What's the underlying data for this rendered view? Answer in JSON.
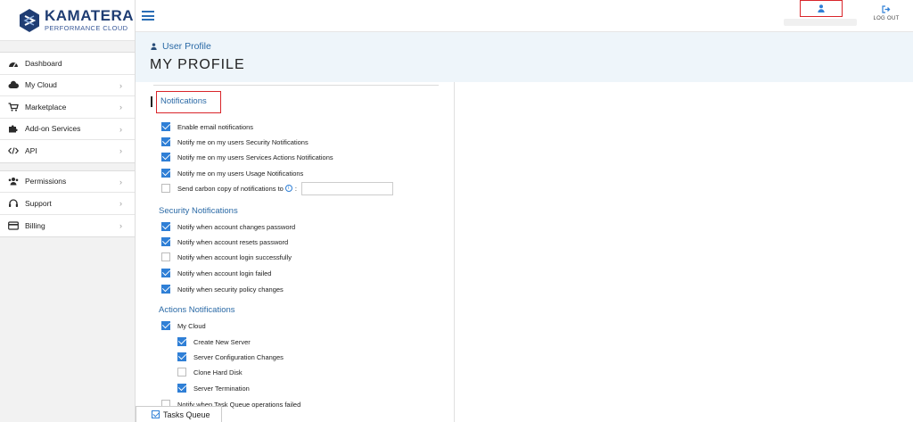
{
  "logo": {
    "name": "KAMATERA",
    "sub": "PERFORMANCE CLOUD"
  },
  "nav_group_1": [
    {
      "label": "Dashboard",
      "icon": "dashboard-icon",
      "chevron": false
    },
    {
      "label": "My Cloud",
      "icon": "cloud-icon",
      "chevron": true
    },
    {
      "label": "Marketplace",
      "icon": "cart-icon",
      "chevron": true
    },
    {
      "label": "Add-on Services",
      "icon": "puzzle-icon",
      "chevron": true
    },
    {
      "label": "API",
      "icon": "code-icon",
      "chevron": true
    }
  ],
  "nav_group_2": [
    {
      "label": "Permissions",
      "icon": "users-icon",
      "chevron": true
    },
    {
      "label": "Support",
      "icon": "headset-icon",
      "chevron": true
    },
    {
      "label": "Billing",
      "icon": "credit-card-icon",
      "chevron": true
    }
  ],
  "topbar": {
    "logout_label": "LOG OUT"
  },
  "header": {
    "breadcrumb": "User Profile",
    "title": "MY PROFILE"
  },
  "sections": {
    "notifications": "Notifications",
    "security": "Security Notifications",
    "actions": "Actions Notifications"
  },
  "notification_items": [
    {
      "label": "Enable email notifications",
      "checked": true
    },
    {
      "label": "Notify me on my users Security Notifications",
      "checked": true
    },
    {
      "label": "Notify me on my users Services Actions Notifications",
      "checked": true
    },
    {
      "label": "Notify me on my users Usage Notifications",
      "checked": true
    },
    {
      "label": "Send carbon copy of notifications to",
      "checked": false
    }
  ],
  "cc_suffix": ":",
  "security_items": [
    {
      "label": "Notify when account changes password",
      "checked": true
    },
    {
      "label": "Notify when account resets password",
      "checked": true
    },
    {
      "label": "Notify when account login successfully",
      "checked": false
    },
    {
      "label": "Notify when account login failed",
      "checked": true
    },
    {
      "label": "Notify when security policy changes",
      "checked": true
    }
  ],
  "action_parent": {
    "label": "My Cloud",
    "checked": true
  },
  "action_items": [
    {
      "label": "Create New Server",
      "checked": true
    },
    {
      "label": "Server Configuration Changes",
      "checked": true
    },
    {
      "label": "Clone Hard Disk",
      "checked": false
    },
    {
      "label": "Server Termination",
      "checked": true
    }
  ],
  "task_queue_item": {
    "label": "Notify when Task Queue operations failed",
    "checked": false
  },
  "tasks_queue_label": "Tasks Queue",
  "colors": {
    "accent": "#2f7fd6",
    "brand": "#1f3d73",
    "highlight": "#d9252a"
  }
}
